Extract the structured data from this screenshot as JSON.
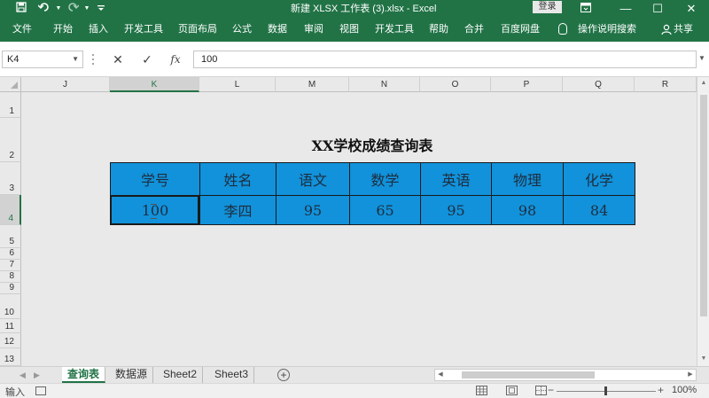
{
  "window": {
    "title": "新建 XLSX 工作表 (3).xlsx  -  Excel",
    "login_label": "登录",
    "controls": [
      "▭",
      "—",
      "☐",
      "✕"
    ]
  },
  "quick_access": {
    "save_icon": "save-icon",
    "undo_icon": "undo-icon",
    "redo_icon": "redo-icon"
  },
  "ribbon": {
    "tabs": [
      "文件",
      "开始",
      "插入",
      "开发工具",
      "页面布局",
      "公式",
      "数据",
      "审阅",
      "视图",
      "开发工具",
      "帮助",
      "合并",
      "百度网盘"
    ],
    "tell_me": "操作说明搜索",
    "share": "共享"
  },
  "formula_bar": {
    "name_box": "K4",
    "cancel": "✕",
    "enter": "✓",
    "fx": "fx",
    "formula": "100"
  },
  "columns": [
    "J",
    "K",
    "L",
    "M",
    "N",
    "O",
    "P",
    "Q",
    "R"
  ],
  "selected_column": "K",
  "rows": [
    "1",
    "2",
    "3",
    "4",
    "5",
    "6",
    "7",
    "8",
    "9",
    "10",
    "11",
    "12",
    "13"
  ],
  "selected_row": "4",
  "sheet": {
    "title": "XX学校成绩查询表",
    "headers": [
      "学号",
      "姓名",
      "语文",
      "数学",
      "英语",
      "物理",
      "化学"
    ],
    "record": [
      "100",
      "李四",
      "95",
      "65",
      "95",
      "98",
      "84"
    ],
    "fill_color": "#1192db"
  },
  "sheet_tabs": [
    "查询表",
    "数据源",
    "Sheet2",
    "Sheet3"
  ],
  "active_sheet": "查询表",
  "add_sheet": "+",
  "status": {
    "mode": "输入",
    "zoom_minus": "−",
    "zoom_plus": "+",
    "zoom": "100%"
  },
  "colors": {
    "accent": "#217346"
  }
}
